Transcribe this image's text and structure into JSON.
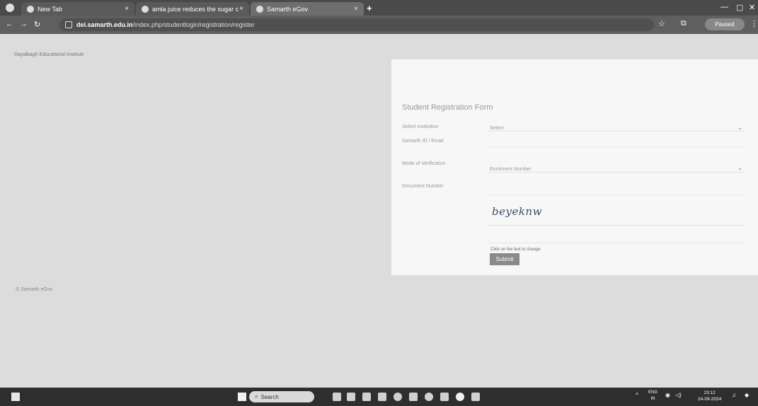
{
  "browser": {
    "tabs": [
      {
        "title": "New Tab"
      },
      {
        "title": "amla juice reduces the sugar c"
      },
      {
        "title": "Samarth eGov"
      }
    ],
    "url_host": "dei.samarth.edu.in",
    "url_path": "/index.php/studentlogin/registration/register",
    "profile_status": "Paused"
  },
  "page": {
    "institution_name": "Dayalbagh Educational Institute",
    "form": {
      "title": "Student Registration Form",
      "select_institution_label": "Select Institution",
      "select_institution_value": "Select",
      "samarth_id_label": "Samarth ID / Email",
      "mode_label": "Mode of Verification",
      "mode_value": "Enrolment Number",
      "document_number_label": "Document Number",
      "captcha_text": "beyeknw",
      "captcha_hint": "Click on the text to change",
      "submit_label": "Submit"
    },
    "footer": "© Samarth eGov"
  },
  "taskbar": {
    "search_label": "Search",
    "language_line1": "ENG",
    "language_line2": "IN",
    "time": "23:12",
    "date": "24-09-2024"
  }
}
